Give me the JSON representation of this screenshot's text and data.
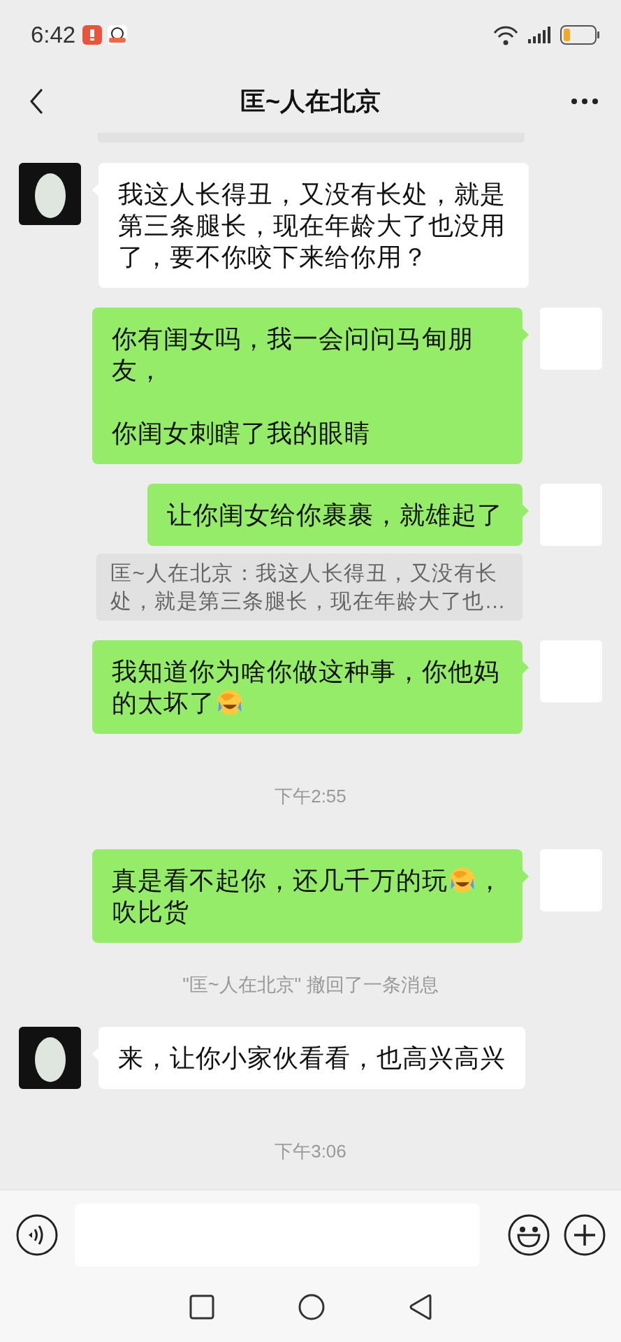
{
  "status_bar": {
    "time": "6:42"
  },
  "header": {
    "title": "匡~人在北京"
  },
  "messages": [
    {
      "kind": "incoming",
      "parts": [
        {
          "kind": "text",
          "text": "我这人长得丑，又没有长处，就是第三条腿长，现在年龄大了也没用了，要不你咬下来给你用？"
        }
      ]
    },
    {
      "kind": "outgoing",
      "parts": [
        {
          "kind": "text",
          "text": "你有闺女吗，我一会问问马甸朋友，"
        },
        {
          "kind": "paragraph_break"
        },
        {
          "kind": "text",
          "text": "你闺女刺瞎了我的眼睛"
        }
      ]
    },
    {
      "kind": "outgoing",
      "parts": [
        {
          "kind": "text",
          "text": "让你闺女给你裹裹，就雄起了"
        }
      ]
    },
    {
      "kind": "quote",
      "text": "匡~人在北京：我这人长得丑，又没有长处，就是第三条腿长，现在年龄大了也…"
    },
    {
      "kind": "outgoing",
      "parts": [
        {
          "kind": "text",
          "text": "我知道你为啥你做这种事，你他妈的太坏了"
        },
        {
          "kind": "emoji"
        }
      ]
    },
    {
      "kind": "time",
      "text": "下午2:55"
    },
    {
      "kind": "outgoing",
      "parts": [
        {
          "kind": "text",
          "text": "真是看不起你，还几千万的玩"
        },
        {
          "kind": "emoji"
        },
        {
          "kind": "text",
          "text": "，吹比货"
        }
      ]
    },
    {
      "kind": "notice",
      "text": "\"匡~人在北京\" 撤回了一条消息"
    },
    {
      "kind": "incoming",
      "parts": [
        {
          "kind": "text",
          "text": "来，让你小家伙看看，也高兴高兴"
        }
      ]
    },
    {
      "kind": "time",
      "text": "下午3:06"
    }
  ]
}
